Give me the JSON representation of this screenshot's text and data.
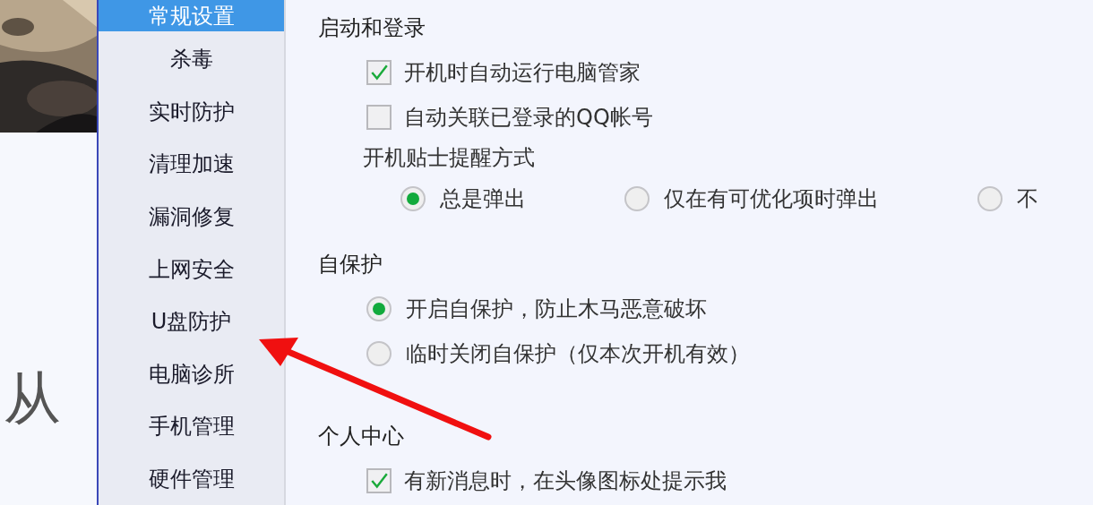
{
  "left_panel": {
    "text": "从"
  },
  "sidebar": {
    "items": [
      {
        "label": "常规设置",
        "selected": true
      },
      {
        "label": "杀毒",
        "selected": false
      },
      {
        "label": "实时防护",
        "selected": false
      },
      {
        "label": "清理加速",
        "selected": false
      },
      {
        "label": "漏洞修复",
        "selected": false
      },
      {
        "label": "上网安全",
        "selected": false
      },
      {
        "label": "U盘防护",
        "selected": false
      },
      {
        "label": "电脑诊所",
        "selected": false
      },
      {
        "label": "手机管理",
        "selected": false
      },
      {
        "label": "硬件管理",
        "selected": false
      }
    ]
  },
  "sections": [
    {
      "title": "启动和登录",
      "rows": [
        {
          "kind": "checkbox",
          "label": "开机时自动运行电脑管家",
          "checked": true
        },
        {
          "kind": "checkbox",
          "label": "自动关联已登录的QQ帐号",
          "checked": false
        },
        {
          "kind": "caption",
          "label": "开机贴士提醒方式"
        },
        {
          "kind": "radio_row",
          "options": [
            {
              "label": "总是弹出",
              "selected": true
            },
            {
              "label": "仅在有可优化项时弹出",
              "selected": false
            },
            {
              "label": "不",
              "selected": false
            }
          ]
        }
      ]
    },
    {
      "title": "自保护",
      "rows": [
        {
          "kind": "radio",
          "label": "开启自保护，防止木马恶意破坏",
          "selected": true
        },
        {
          "kind": "radio",
          "label": "临时关闭自保护（仅本次开机有效）",
          "selected": false
        }
      ]
    },
    {
      "title": "个人中心",
      "rows": [
        {
          "kind": "checkbox",
          "label": "有新消息时，在头像图标处提示我",
          "checked": true
        }
      ]
    }
  ]
}
